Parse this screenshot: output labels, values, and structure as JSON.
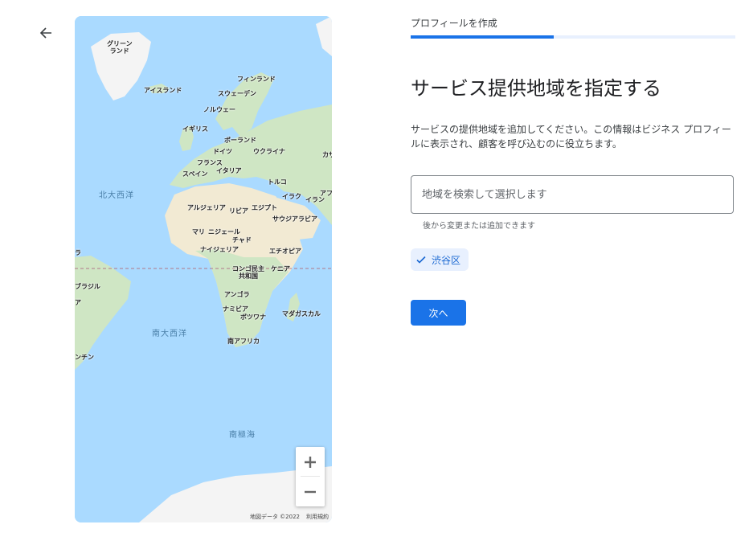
{
  "header": {
    "step_label": "プロフィールを作成",
    "progress": 0.44
  },
  "nav": {
    "back_icon": "arrow-left-icon"
  },
  "main": {
    "title": "サービス提供地域を指定する",
    "description": "サービスの提供地域を追加してください。この情報はビジネス プロフィールに表示され、顧客を呼び込むのに役立ちます。",
    "search": {
      "placeholder": "地域を検索して選択します",
      "value": ""
    },
    "helper_text": "後から変更または追加できます",
    "selected_areas": [
      {
        "label": "渋谷区",
        "icon": "check-icon"
      }
    ],
    "next_label": "次へ"
  },
  "map": {
    "labels": {
      "greenland": "グリーン\nランド",
      "iceland": "アイスランド",
      "finland": "フィンランド",
      "sweden": "スウェーデン",
      "norway": "ノルウェー",
      "uk": "イギリス",
      "poland": "ポーランド",
      "germany": "ドイツ",
      "ukraine": "ウクライナ",
      "kazakh": "カザ",
      "france": "フランス",
      "spain": "スペイン",
      "italy": "イタリア",
      "turkey": "トルコ",
      "north_atlantic": "北大西洋",
      "iraq": "イラク",
      "iran": "イラン",
      "af": "アフ",
      "algeria": "アルジェリア",
      "libya": "リビア",
      "egypt": "エジプト",
      "saudi": "サウジアラビア",
      "mali": "マリ",
      "niger": "ニジェール",
      "chad": "チャド",
      "nigeria": "ナイジェリア",
      "ethiopia": "エチオピア",
      "ra": "ラ",
      "congo": "コンゴ民主\n共和国",
      "kenya": "ケニア",
      "brazil": "ブラジル",
      "a": "ア",
      "angola": "アンゴラ",
      "namibia": "ナミビア",
      "botswana": "ボツワナ",
      "madagascar": "マダガスカル",
      "south_atlantic": "南大西洋",
      "south_africa": "南アフリカ",
      "argentina": "ンチン",
      "southern_ocean": "南極海"
    },
    "zoom_in_icon": "plus-icon",
    "zoom_out_icon": "minus-icon",
    "attribution": "地図データ ©2022",
    "terms": "利用規約"
  },
  "colors": {
    "accent": "#1a73e8",
    "ocean": "#aadaff",
    "land": "#cfe6c4",
    "desert": "#f2ead3"
  }
}
